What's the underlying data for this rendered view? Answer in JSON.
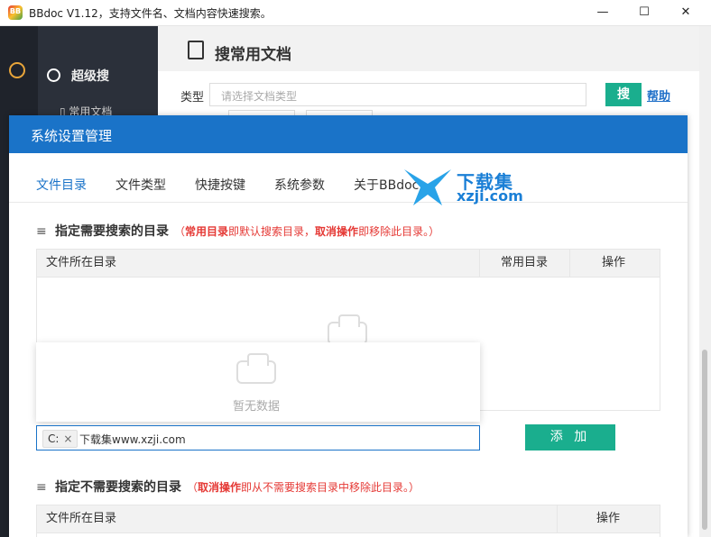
{
  "window": {
    "title": "BBdoc V1.12，支持文件名、文档内容快速搜索。",
    "app_icon_text": "BB",
    "minimize": "—",
    "maximize": "☐",
    "close": "✕"
  },
  "background_app": {
    "menu_label": "超级搜",
    "submenu_label": "常用文档",
    "header_title": "搜常用文档",
    "type_label": "类型",
    "type_placeholder": "请选择文档类型",
    "search_button": "搜",
    "help_link": "帮助"
  },
  "modal": {
    "title": "系统设置管理",
    "tabs": [
      {
        "label": "文件目录",
        "active": true
      },
      {
        "label": "文件类型",
        "active": false
      },
      {
        "label": "快捷按键",
        "active": false
      },
      {
        "label": "系统参数",
        "active": false
      },
      {
        "label": "关于BBdoc",
        "active": false
      }
    ],
    "section1": {
      "icon": "≡",
      "title": "指定需要搜索的目录",
      "note_open": "（",
      "note_highlight1": "常用目录",
      "note_mid": "即默认搜索目录，",
      "note_highlight2": "取消操作",
      "note_tail": "即移除此目录。）",
      "columns": [
        "文件所在目录",
        "常用目录",
        "操作"
      ]
    },
    "dropdown": {
      "empty_text": "暂无数据"
    },
    "dir_input": {
      "tag": "C:",
      "tag_close": "×",
      "value": "下载集www.xzji.com"
    },
    "add_button": "添 加",
    "section2": {
      "icon": "≡",
      "title": "指定不需要搜索的目录",
      "note_open": "（",
      "note_highlight": "取消操作",
      "note_tail": "即从不需要搜索目录中移除此目录。）",
      "columns": [
        "文件所在目录",
        "操作"
      ]
    }
  },
  "watermark": {
    "line1": "下载集",
    "line2": "xzji.com"
  },
  "colors": {
    "primary_blue": "#1a73c8",
    "accent_green": "#1aae8e",
    "warning_red": "#e53935",
    "sidebar_dark": "#2b303a"
  }
}
